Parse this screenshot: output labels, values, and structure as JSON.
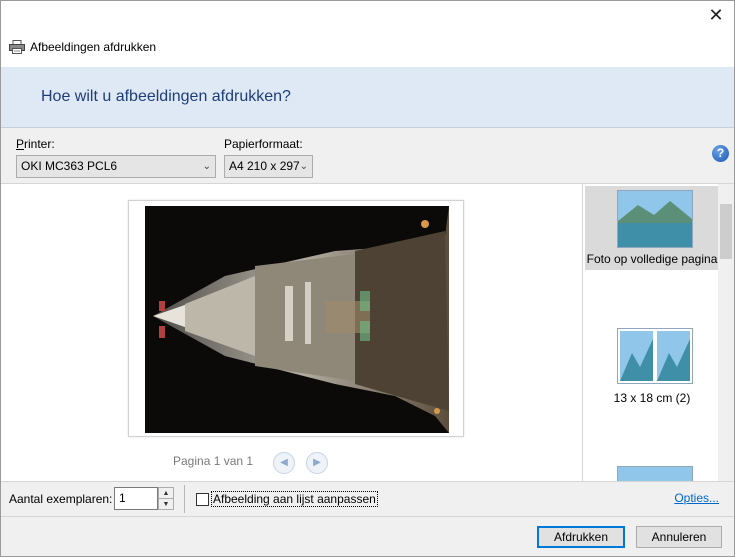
{
  "window": {
    "title": "Afbeeldingen afdrukken",
    "close_glyph": "✕"
  },
  "banner": {
    "heading": "Hoe wilt u afbeeldingen afdrukken?"
  },
  "settings": {
    "printer_label": "Printer:",
    "printer_value": "OKI MC363 PCL6",
    "paper_label": "Papierformaat:",
    "paper_value": "A4 210 x 297",
    "help_glyph": "?"
  },
  "preview": {
    "pager_text": "Pagina 1 van 1",
    "prev_glyph": "◀",
    "next_glyph": "▶"
  },
  "layouts": {
    "items": [
      {
        "label": "Foto op volledige pagina",
        "selected": true
      },
      {
        "label": "13 x 18 cm (2)",
        "selected": false
      }
    ]
  },
  "bottom": {
    "copies_label": "Aantal exemplaren:",
    "copies_value": "1",
    "fit_label": "Afbeelding aan lijst aanpassen",
    "fit_checked": false,
    "options_link": "Opties..."
  },
  "footer": {
    "print_button": "Afdrukken",
    "cancel_button": "Annuleren"
  },
  "colors": {
    "banner_bg": "#dfe9f5",
    "heading": "#1e3d78",
    "link": "#0066cc",
    "default_button_border": "#0078d7"
  },
  "icons": [
    "printer-icon",
    "help-icon",
    "close-icon",
    "prev-page-icon",
    "next-page-icon"
  ]
}
